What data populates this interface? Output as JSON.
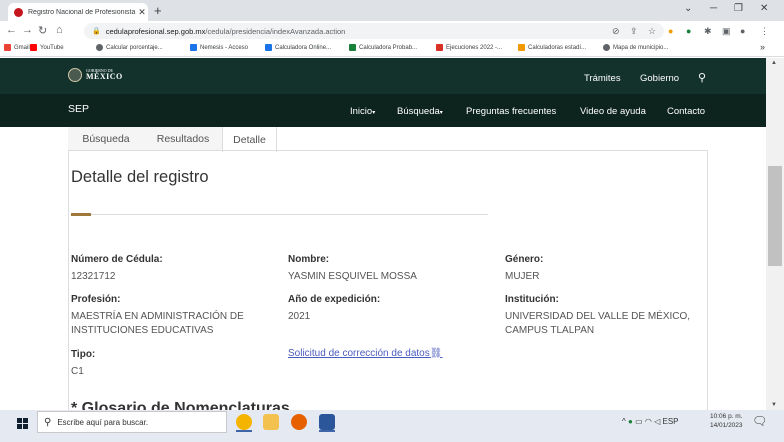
{
  "browser": {
    "tab_title": "Registro Nacional de Profesionista",
    "tab_close": "✕",
    "new_tab": "+",
    "url_host": "cedulaprofesional.sep.gob.mx",
    "url_path": "/cedula/presidencia/indexAvanzada.action",
    "bookmarks": [
      {
        "label": "Gmail",
        "color": "#ea4335"
      },
      {
        "label": "YouTube",
        "color": "#ff0000"
      },
      {
        "label": "Calcular porcentaje...",
        "color": "#5f6368"
      },
      {
        "label": "Nemesis - Acceso",
        "color": "#1a73e8"
      },
      {
        "label": "Calculadora Online...",
        "color": "#1a73e8"
      },
      {
        "label": "Calculadora Probab...",
        "color": "#188038"
      },
      {
        "label": "Ejecuciones 2022 -...",
        "color": "#d93025"
      },
      {
        "label": "Calculadoras estadí...",
        "color": "#f29900"
      },
      {
        "label": "Mapa de municipio...",
        "color": "#5f6368"
      }
    ],
    "bookmarks_more": "»"
  },
  "gov_header": {
    "logo_line1": "GOBIERNO DE",
    "logo_line2": "MÉXICO",
    "tramites": "Trámites",
    "gobierno": "Gobierno",
    "search_icon": "search-icon"
  },
  "sep_nav": {
    "brand": "SEP",
    "inicio": "Inicio",
    "busqueda": "Búsqueda",
    "preguntas": "Preguntas frecuentes",
    "video": "Video de ayuda",
    "contacto": "Contacto",
    "caret": "▾"
  },
  "page_tabs": {
    "busqueda": "Búsqueda",
    "resultados": "Resultados",
    "detalle": "Detalle"
  },
  "detail": {
    "title": "Detalle del registro",
    "cedula_label": "Número de Cédula:",
    "cedula_value": "12321712",
    "nombre_label": "Nombre:",
    "nombre_value": "YASMIN ESQUIVEL MOSSA",
    "genero_label": "Género:",
    "genero_value": "MUJER",
    "profesion_label": "Profesión:",
    "profesion_value_1": "MAESTRÍA EN ADMINISTRACIÓN DE",
    "profesion_value_2": "INSTITUCIONES EDUCATIVAS",
    "anio_label": "Año de expedición:",
    "anio_value": "2021",
    "institucion_label": "Institución:",
    "institucion_value_1": "UNIVERSIDAD DEL VALLE DE MÉXICO,",
    "institucion_value_2": "CAMPUS TLALPAN",
    "tipo_label": "Tipo:",
    "tipo_value": "C1",
    "correccion_link": "Solicitud de corrección de datos",
    "glosario_partial": "* Glosario de Nomenclaturas"
  },
  "taskbar": {
    "search_placeholder": "Escribe aquí para buscar.",
    "lang": "ESP",
    "time": "10:06 p. m.",
    "date": "14/01/2023"
  },
  "colors": {
    "gov_green": "#13322b",
    "sep_green": "#0c231e",
    "accent_gold": "#a0783c",
    "link_blue": "#4a5bbf"
  }
}
